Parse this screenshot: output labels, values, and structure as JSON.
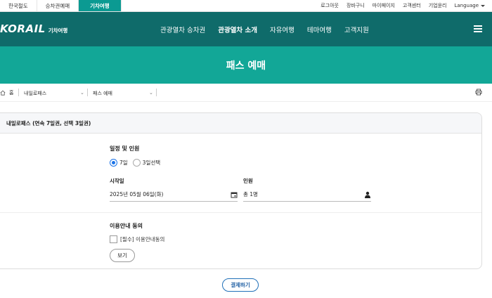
{
  "topbar": {
    "tabs": [
      {
        "label": "한국철도"
      },
      {
        "label": "승차권예매"
      },
      {
        "label": "기차여행"
      }
    ],
    "links": [
      {
        "label": "로그아웃"
      },
      {
        "label": "장바구니"
      },
      {
        "label": "마이페이지"
      },
      {
        "label": "고객센터"
      },
      {
        "label": "기업윤리"
      }
    ],
    "language_label": "Language"
  },
  "header": {
    "logo_text": "KORAIL",
    "logo_sub": "기차여행",
    "nav": [
      {
        "label": "관광열차 승차권"
      },
      {
        "label": "관광열차 소개"
      },
      {
        "label": "자유여행"
      },
      {
        "label": "테마여행"
      },
      {
        "label": "고객지원"
      }
    ]
  },
  "page_title": "패스 예매",
  "breadcrumb": {
    "home": "홈",
    "level1": "내일로패스",
    "level2": "패스 예매"
  },
  "card": {
    "title": "내일로패스 (연속 7일권, 선택 3일권)",
    "schedule_title": "일정 및 인원",
    "options": [
      {
        "label": "7일",
        "checked": true
      },
      {
        "label": "3일선택",
        "checked": false
      }
    ],
    "start_date_label": "시작일",
    "start_date_value": "2025년 05월 06일(화)",
    "people_label": "인원",
    "people_value": "총 1명",
    "agreement_title": "이용안내 동의",
    "agreement_checkbox": "[필수] 이용안내동의",
    "view_button": "보기"
  },
  "pay_button": "결제하기",
  "colors": {
    "header_bg": "#0f6b6a",
    "band_bg": "#12a797",
    "active_tab": "#0b9a92",
    "radio_accent": "#1a73e8",
    "pay_button_border": "#1f6fb8"
  },
  "icons": [
    "home-icon",
    "chevron-down-icon",
    "print-icon",
    "calendar-icon",
    "person-icon",
    "hamburger-icon"
  ]
}
